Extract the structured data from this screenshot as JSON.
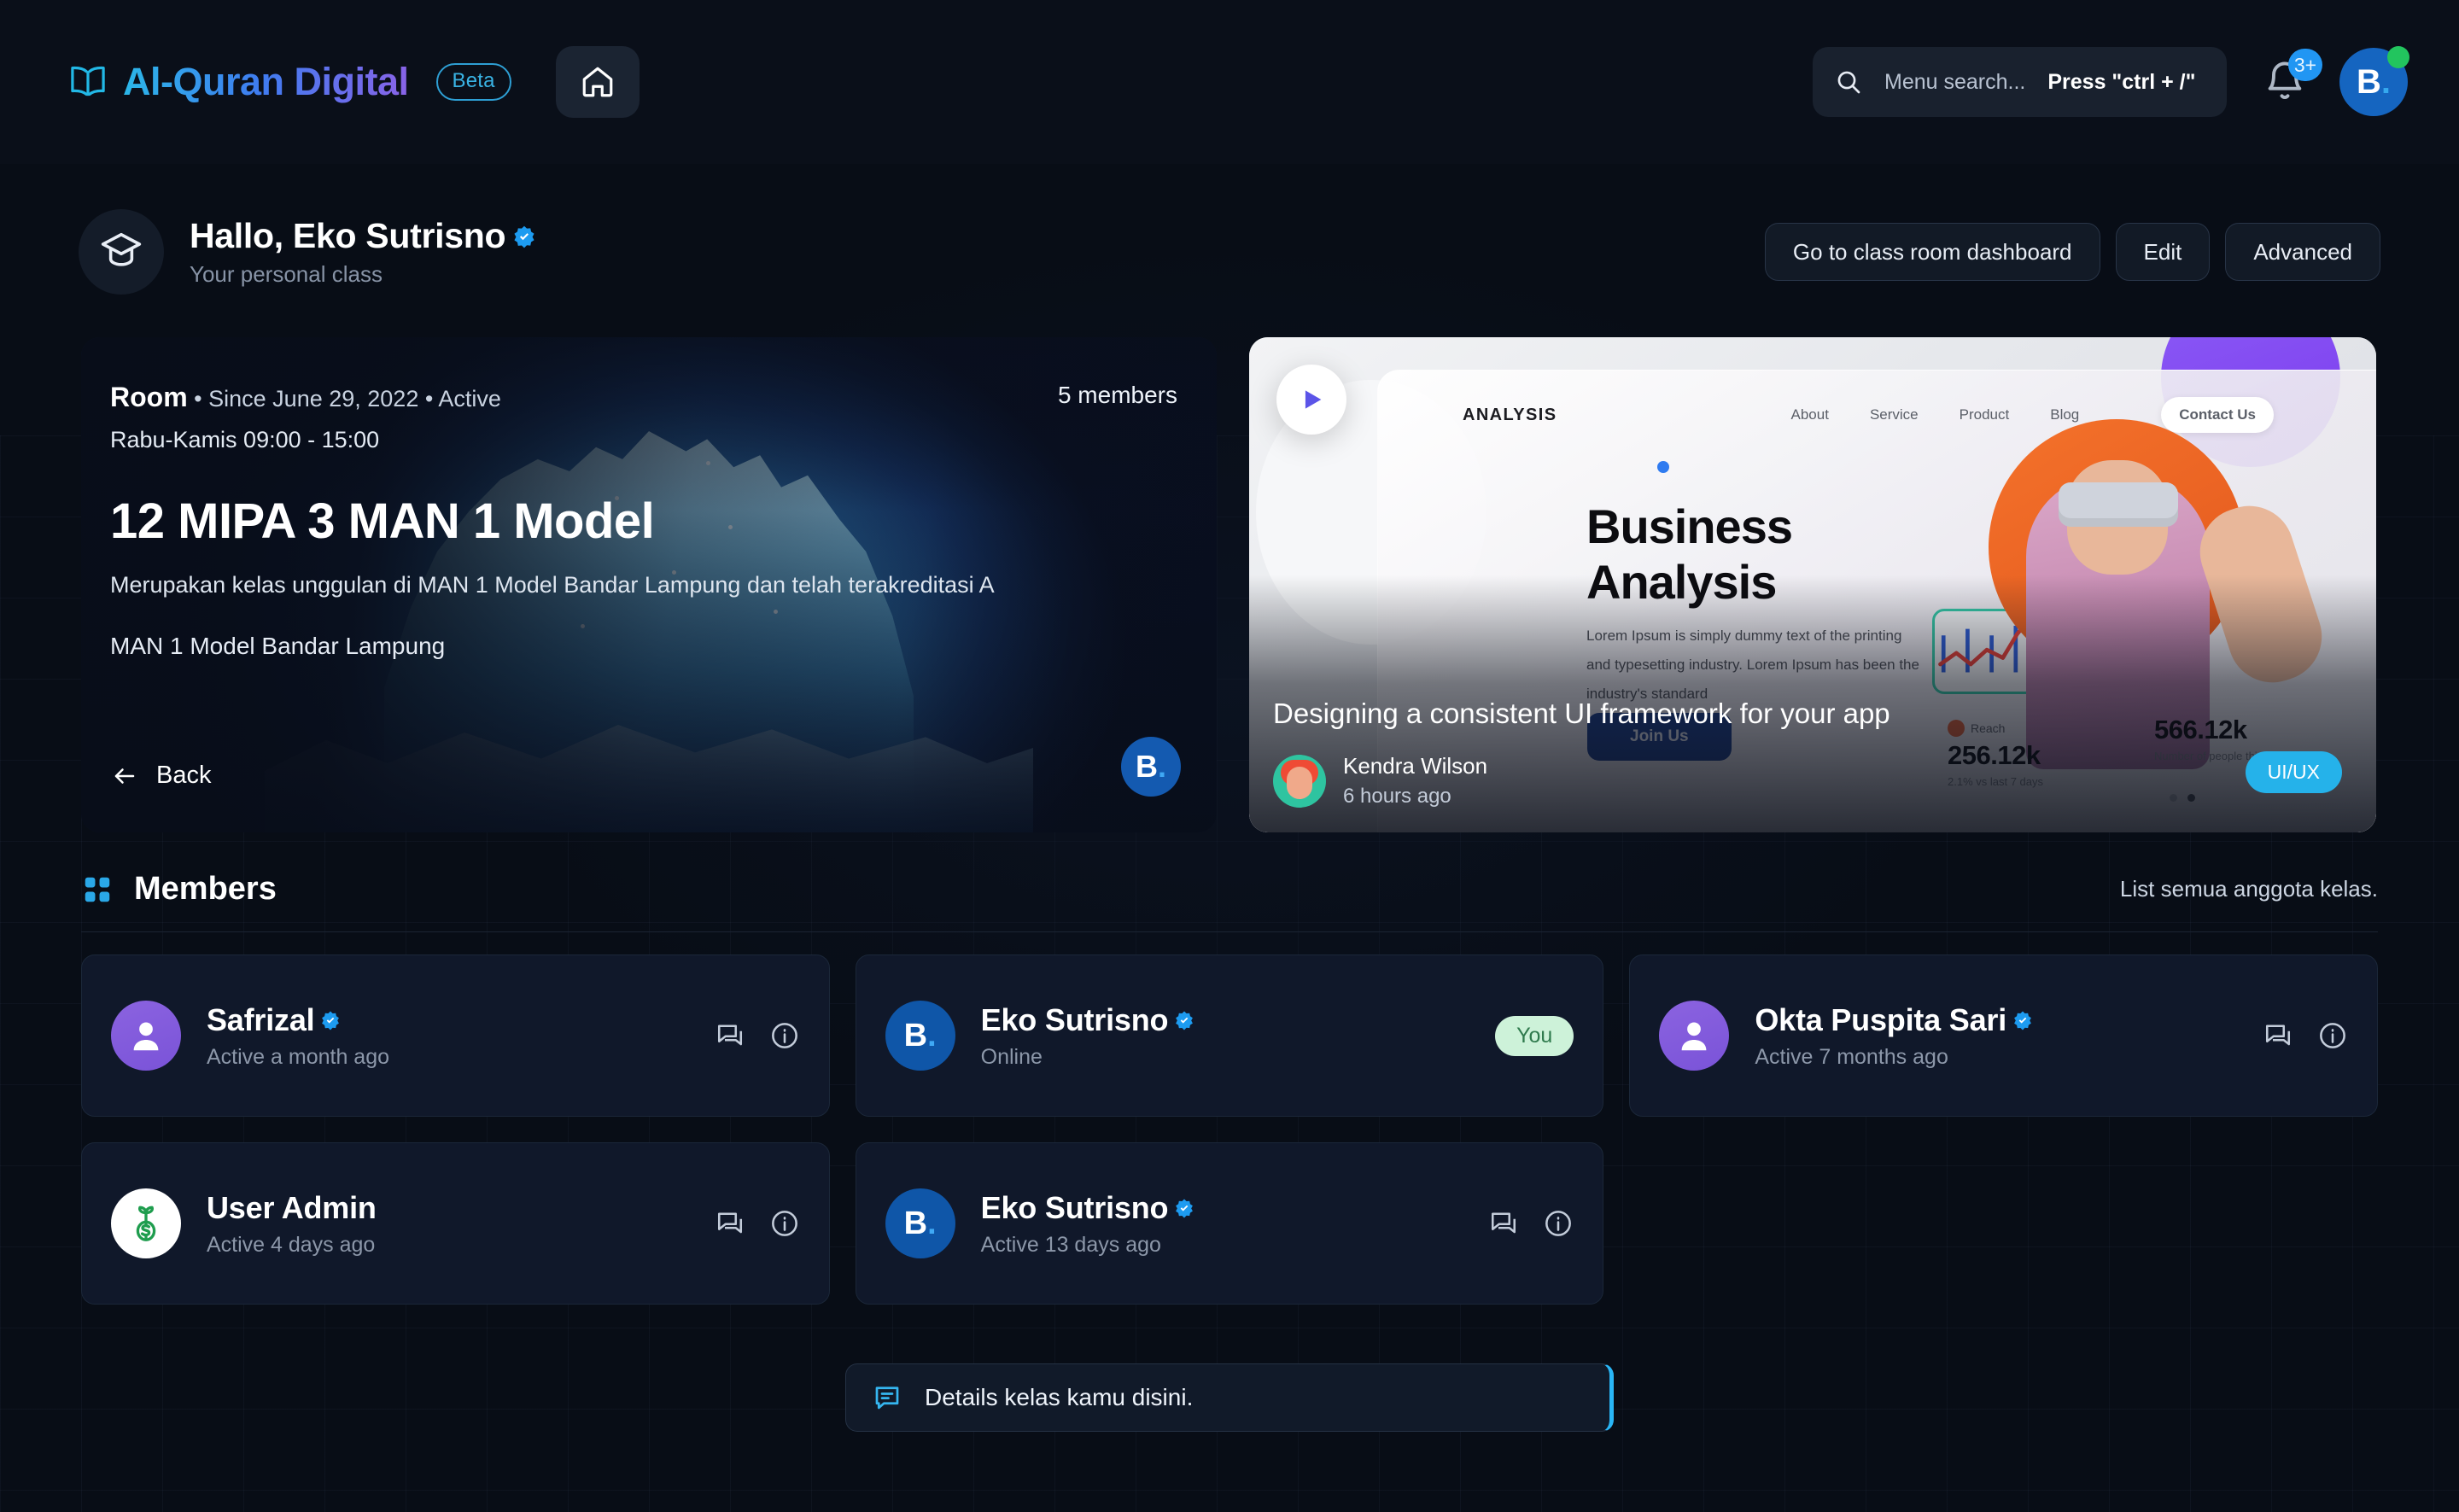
{
  "brand": {
    "name": "Al-Quran Digital",
    "badge": "Beta",
    "logo_icon": "book-icon",
    "home_icon": "home-icon"
  },
  "search": {
    "icon": "search-icon",
    "placeholder": "Menu search...",
    "hint": "Press \"ctrl + /\""
  },
  "notifications": {
    "icon": "bell-icon",
    "count": "3+"
  },
  "account": {
    "initial": "B",
    "dot": ".",
    "presence": "online"
  },
  "profile": {
    "icon": "graduation-cap-icon",
    "greeting": "Hallo, Eko Sutrisno",
    "verified": true,
    "subtitle": "Your personal class"
  },
  "header_actions": [
    {
      "label": "Go to class room dashboard",
      "name": "go-to-class-room-dashboard-button"
    },
    {
      "label": "Edit",
      "name": "edit-button"
    },
    {
      "label": "Advanced",
      "name": "advanced-button"
    }
  ],
  "room": {
    "label": "Room",
    "since": "Since June 29, 2022",
    "status": "Active",
    "schedule": "Rabu-Kamis 09:00 - 15:00",
    "members_count": "5 members",
    "title": "12 MIPA 3 MAN 1 Model",
    "description": "Merupakan kelas unggulan di MAN 1 Model Bandar Lampung dan telah terakreditasi A",
    "school": "MAN 1 Model Bandar Lampung",
    "back_label": "Back",
    "logo_initial": "B",
    "logo_dot": "."
  },
  "video": {
    "caption": "Designing a consistent UI framework for your app",
    "author": "Kendra Wilson",
    "time": "6 hours ago",
    "tag": "UI/UX",
    "play_icon": "play-icon",
    "preview": {
      "logo": "ANALYSIS",
      "nav": [
        "About",
        "Service",
        "Product",
        "Blog"
      ],
      "contact": "Contact Us",
      "heading_line1": "Business",
      "heading_line2": "Analysis",
      "paragraph": "Lorem Ipsum is simply dummy text of the printing and typesetting industry. Lorem Ipsum has been the industry's standard",
      "cta": "Join Us",
      "stat1_label": "Reach",
      "stat1_value": "256.12k",
      "stat1_sub": "2.1% vs last 7 days",
      "stat2_value": "566.12k",
      "stat2_sub": "Number of people this project."
    }
  },
  "members_section": {
    "icon": "grid-dots-icon",
    "title": "Members",
    "note": "List semua anggota kelas."
  },
  "members": [
    {
      "name": "Safrizal",
      "status": "Active a month ago",
      "verified": true,
      "avatar_type": "purple-person",
      "badge": null,
      "actions": [
        "chat-icon",
        "info-icon"
      ]
    },
    {
      "name": "Eko Sutrisno",
      "status": "Online",
      "verified": true,
      "avatar_type": "blue-initial",
      "avatar_initial": "B",
      "avatar_dot": ".",
      "badge": "You",
      "actions": []
    },
    {
      "name": "Okta Puspita Sari",
      "status": "Active 7 months ago",
      "verified": true,
      "avatar_type": "purple-person",
      "badge": null,
      "actions": [
        "chat-icon",
        "info-icon"
      ]
    },
    {
      "name": "User Admin",
      "status": "Active 4 days ago",
      "verified": false,
      "avatar_type": "white-money-plant",
      "badge": null,
      "actions": [
        "chat-icon",
        "info-icon"
      ]
    },
    {
      "name": "Eko Sutrisno",
      "status": "Active 13 days ago",
      "verified": true,
      "avatar_type": "blue-initial",
      "avatar_initial": "B",
      "avatar_dot": ".",
      "badge": null,
      "actions": [
        "chat-icon",
        "info-icon"
      ]
    }
  ],
  "toast": {
    "icon": "message-icon",
    "text": "Details kelas kamu disini."
  },
  "colors": {
    "page_bg": "#080d16",
    "card_bg": "#10182a",
    "accent_blue": "#29b6f6",
    "accent_purple": "#8b5cf6",
    "verified_blue": "#1d9bf0",
    "online_green": "#22c55e",
    "you_badge_bg": "#cdf2d9"
  }
}
